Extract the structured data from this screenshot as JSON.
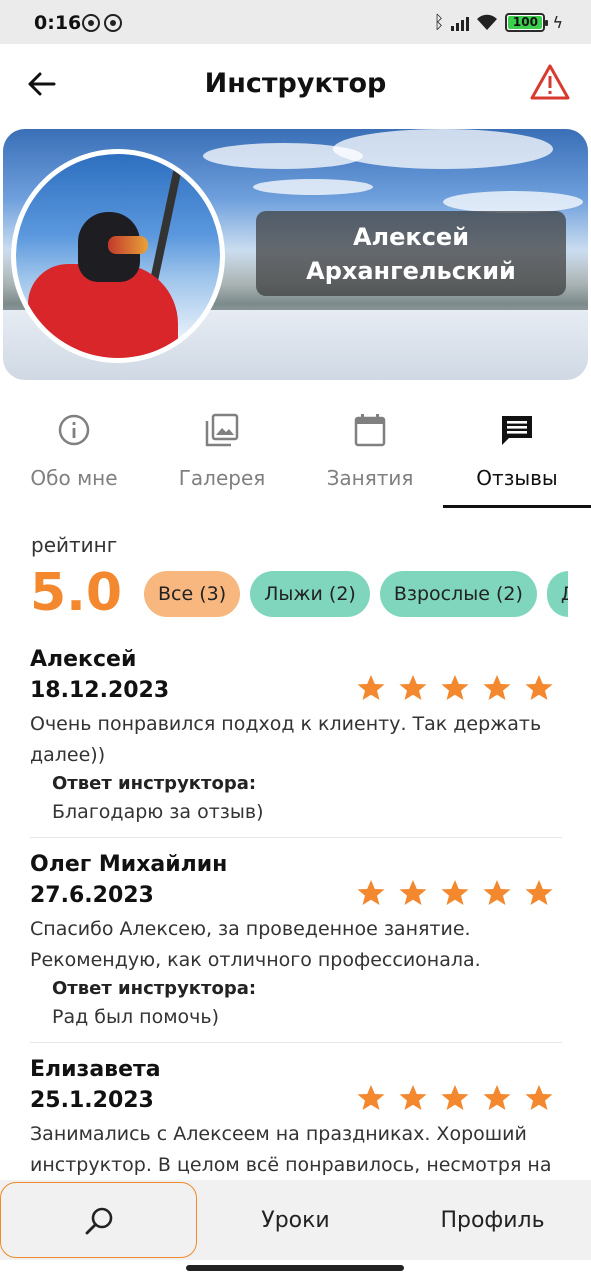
{
  "status_bar": {
    "time": "0:16",
    "battery": "100",
    "icons": [
      "notification-icon",
      "notification-icon",
      "bluetooth-icon",
      "signal-icon",
      "wifi-icon",
      "battery-icon",
      "charging-icon"
    ]
  },
  "header": {
    "title": "Инструктор",
    "back_icon": "back-arrow-icon",
    "report_icon": "warning-icon"
  },
  "profile": {
    "first_name": "Алексей",
    "last_name": "Архангельский"
  },
  "tabs": [
    {
      "label": "Обо мне",
      "icon": "info-icon",
      "active": false
    },
    {
      "label": "Галерея",
      "icon": "gallery-icon",
      "active": false
    },
    {
      "label": "Занятия",
      "icon": "calendar-icon",
      "active": false
    },
    {
      "label": "Отзывы",
      "icon": "comment-icon",
      "active": true
    }
  ],
  "rating": {
    "label": "рейтинг",
    "value": "5.0"
  },
  "filters": [
    {
      "label": "Все (3)",
      "selected": true
    },
    {
      "label": "Лыжи (2)",
      "selected": false
    },
    {
      "label": "Взрослые (2)",
      "selected": false
    },
    {
      "label": "Д",
      "selected": false
    }
  ],
  "reviews": [
    {
      "name": "Алексей",
      "date": "18.12.2023",
      "stars": 5,
      "text": "Очень понравился подход к клиенту. Так держать далее))",
      "reply_label": "Ответ инструктора:",
      "reply": "Благодарю за отзыв)"
    },
    {
      "name": "Олег Михайлин",
      "date": "27.6.2023",
      "stars": 5,
      "text": "Спасибо Алексею, за проведенное занятие. Рекомендую, как отличного профессионала.",
      "reply_label": "Ответ инструктора:",
      "reply": "Рад был помочь)"
    },
    {
      "name": "Елизавета",
      "date": "25.1.2023",
      "stars": 5,
      "text": "Занимались с Алексеем на праздниках. Хороший инструктор. В целом всё понравилось, несмотря на"
    }
  ],
  "bottom_nav": {
    "search_icon": "search-icon",
    "lessons": "Уроки",
    "profile": "Профиль"
  },
  "colors": {
    "accent": "#f3882e",
    "chip_selected": "#f7b77f",
    "chip": "#7fd6bd",
    "star": "#f3882e"
  }
}
